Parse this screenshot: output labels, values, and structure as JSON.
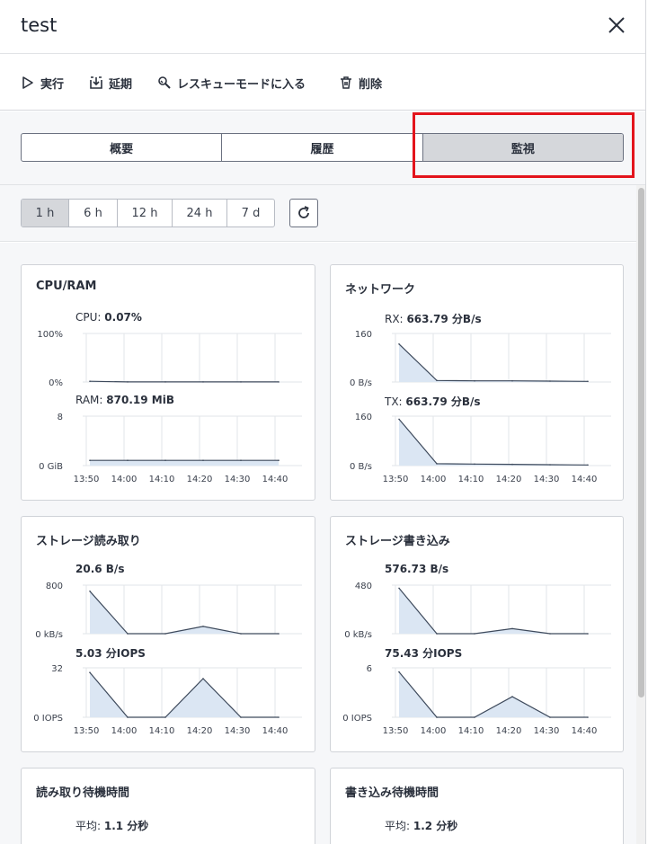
{
  "header": {
    "title": "test",
    "close_icon": "close-icon"
  },
  "toolbar": {
    "run": "実行",
    "postpone": "延期",
    "rescue": "レスキューモードに入る",
    "delete": "削除"
  },
  "tabs": [
    "概要",
    "履歴",
    "監視"
  ],
  "active_tab": "監視",
  "highlight_color": "#e3141c",
  "time_ranges": [
    "1 h",
    "6 h",
    "12 h",
    "24 h",
    "7 d"
  ],
  "active_range": "1 h",
  "x_ticks": [
    "13:50",
    "14:00",
    "14:10",
    "14:20",
    "14:30",
    "14:40"
  ],
  "cards": {
    "cpu_ram": {
      "title": "CPU/RAM",
      "cpu_label": "CPU:",
      "cpu_value": "0.07%",
      "cpu_ymax": "100%",
      "cpu_ymin": "0%",
      "ram_label": "RAM:",
      "ram_value": "870.19 MiB",
      "ram_ymax": "8",
      "ram_ymin": "0 GiB"
    },
    "network": {
      "title": "ネットワーク",
      "rx_label": "RX:",
      "rx_value": "663.79 分B/s",
      "rx_ymax": "160",
      "rx_ymin": "0 B/s",
      "tx_label": "TX:",
      "tx_value": "663.79 分B/s",
      "tx_ymax": "160",
      "tx_ymin": "0 B/s"
    },
    "storage_read": {
      "title": "ストレージ読み取り",
      "bw_value": "20.6 B/s",
      "bw_ymax": "800",
      "bw_ymin": "0 kB/s",
      "iops_value": "5.03 分IOPS",
      "iops_ymax": "32",
      "iops_ymin": "0 IOPS"
    },
    "storage_write": {
      "title": "ストレージ書き込み",
      "bw_value": "576.73 B/s",
      "bw_ymax": "480",
      "bw_ymin": "0 kB/s",
      "iops_value": "75.43 分IOPS",
      "iops_ymax": "6",
      "iops_ymin": "0 IOPS"
    },
    "read_latency": {
      "title": "読み取り待機時間",
      "avg_label": "平均:",
      "avg_value": "1.1 分秒"
    },
    "write_latency": {
      "title": "書き込み待機時間",
      "avg_label": "平均:",
      "avg_value": "1.2 分秒"
    }
  },
  "chart_data": [
    {
      "type": "area",
      "name": "CPU",
      "x": [
        "13:50",
        "14:00",
        "14:10",
        "14:20",
        "14:30",
        "14:40"
      ],
      "y": [
        1.5,
        0.1,
        0.1,
        0.1,
        0.1,
        0.1
      ],
      "ylim": [
        0,
        100
      ]
    },
    {
      "type": "area",
      "name": "RAM",
      "x": [
        "13:50",
        "14:00",
        "14:10",
        "14:20",
        "14:30",
        "14:40"
      ],
      "y": [
        0.85,
        0.85,
        0.85,
        0.85,
        0.85,
        0.85
      ],
      "ylim": [
        0,
        8
      ]
    },
    {
      "type": "area",
      "name": "RX",
      "x": [
        "13:50",
        "14:00",
        "14:10",
        "14:20",
        "14:30",
        "14:40"
      ],
      "y": [
        125,
        5,
        4,
        4,
        3,
        2
      ],
      "ylim": [
        0,
        160
      ]
    },
    {
      "type": "area",
      "name": "TX",
      "x": [
        "13:50",
        "14:00",
        "14:10",
        "14:20",
        "14:30",
        "14:40"
      ],
      "y": [
        150,
        6,
        5,
        4,
        3,
        2
      ],
      "ylim": [
        0,
        160
      ]
    },
    {
      "type": "area",
      "name": "Storage read B/s",
      "x": [
        "13:50",
        "14:00",
        "14:10",
        "14:20",
        "14:30",
        "14:40"
      ],
      "y": [
        700,
        0,
        0,
        120,
        0,
        0
      ],
      "ylim": [
        0,
        800
      ]
    },
    {
      "type": "area",
      "name": "Storage read IOPS",
      "x": [
        "13:50",
        "14:00",
        "14:10",
        "14:20",
        "14:30",
        "14:40"
      ],
      "y": [
        29,
        0,
        0,
        25,
        0,
        0
      ],
      "ylim": [
        0,
        32
      ]
    },
    {
      "type": "area",
      "name": "Storage write B/s",
      "x": [
        "13:50",
        "14:00",
        "14:10",
        "14:20",
        "14:30",
        "14:40"
      ],
      "y": [
        450,
        0,
        0,
        50,
        0,
        0
      ],
      "ylim": [
        0,
        480
      ]
    },
    {
      "type": "area",
      "name": "Storage write IOPS",
      "x": [
        "13:50",
        "14:00",
        "14:10",
        "14:20",
        "14:30",
        "14:40"
      ],
      "y": [
        5.5,
        0,
        0,
        2.5,
        0,
        0
      ],
      "ylim": [
        0,
        6
      ]
    }
  ]
}
